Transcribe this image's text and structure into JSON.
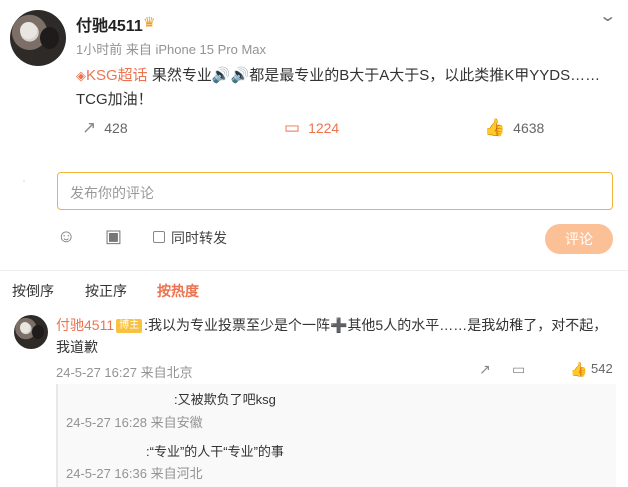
{
  "post": {
    "author": "付驰4511",
    "time": "1小时前",
    "source": "来自 iPhone 15 Pro Max",
    "topic": "KSG超话",
    "text_line1": " 果然专业🔊🔊都是最专业的B大于A大于S，以此类推K甲YYDS……",
    "text_line2": "TCG加油！",
    "repost_count": "428",
    "comment_count": "1224",
    "like_count": "4638"
  },
  "composer": {
    "placeholder": "发布你的评论",
    "repost_label": "同时转发",
    "submit_label": "评论"
  },
  "sort": {
    "by_reverse": "按倒序",
    "by_order": "按正序",
    "by_hot": "按热度"
  },
  "comment": {
    "user": "付驰4511",
    "badge": "博主",
    "text_a": ":我以为专业投票至少是个一阵",
    "text_b": "其他5人的水平……是我幼稚了，对不起，我道歉",
    "time": "24-5-27 16:27",
    "source": "来自北京",
    "likes": "542"
  },
  "replies": [
    {
      "text": ":又被欺负了吧ksg",
      "time": "24-5-27 16:28",
      "source": "来自安徽"
    },
    {
      "text": ":“专业”的人干“专业”的事",
      "time": "24-5-27 16:36",
      "source": "来自河北"
    }
  ],
  "icons": [
    "crown-icon",
    "chevron-down-icon",
    "repost-icon",
    "comment-icon",
    "like-icon",
    "emoji-icon",
    "image-icon",
    "share-icon",
    "plus-icon"
  ],
  "colors": {
    "accent": "#eb7350",
    "input_border": "#f3b23d",
    "submit_bg": "#fcc097"
  }
}
